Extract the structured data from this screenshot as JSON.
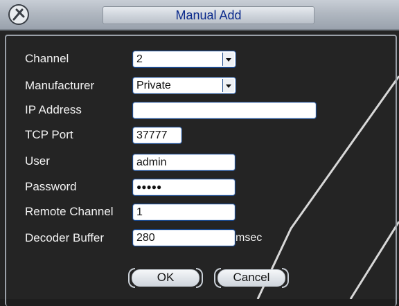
{
  "window": {
    "title": "Manual Add",
    "icon": "tools-icon"
  },
  "fields": [
    {
      "label": "Channel",
      "value": "2",
      "type": "dropdown"
    },
    {
      "label": "Manufacturer",
      "value": "Private",
      "type": "dropdown"
    },
    {
      "label": "IP Address",
      "value": "",
      "type": "text"
    },
    {
      "label": "TCP Port",
      "value": "37777",
      "type": "text"
    },
    {
      "label": "User",
      "value": "admin",
      "type": "text"
    },
    {
      "label": "Password",
      "value": "●●●●●",
      "type": "password"
    },
    {
      "label": "Remote Channel",
      "value": "1",
      "type": "text"
    },
    {
      "label": "Decoder Buffer",
      "value": "280",
      "type": "text",
      "unit": "msec"
    }
  ],
  "buttons": {
    "ok": "OK",
    "cancel": "Cancel"
  }
}
